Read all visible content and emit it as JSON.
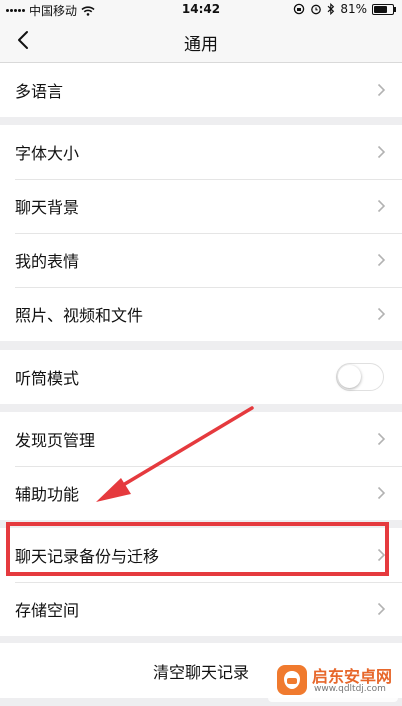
{
  "status_bar": {
    "carrier": "中国移动",
    "time": "14:42",
    "battery_percent": "81%",
    "battery_level": 0.81
  },
  "nav": {
    "title": "通用",
    "back_icon": "chevron-left-icon"
  },
  "groups": [
    {
      "items": [
        {
          "label": "多语言"
        }
      ]
    },
    {
      "items": [
        {
          "label": "字体大小"
        },
        {
          "label": "聊天背景"
        },
        {
          "label": "我的表情"
        },
        {
          "label": "照片、视频和文件"
        }
      ]
    },
    {
      "items": [
        {
          "label": "听筒模式",
          "toggle": false
        }
      ]
    },
    {
      "items": [
        {
          "label": "发现页管理"
        },
        {
          "label": "辅助功能"
        }
      ]
    },
    {
      "items": [
        {
          "label": "聊天记录备份与迁移"
        },
        {
          "label": "存储空间"
        }
      ]
    }
  ],
  "clear_chat": "清空聊天记录",
  "annotation": {
    "highlight_color": "#e53a3e"
  },
  "watermark": {
    "name": "启东安卓网",
    "url": "www.qdltdj.com"
  }
}
